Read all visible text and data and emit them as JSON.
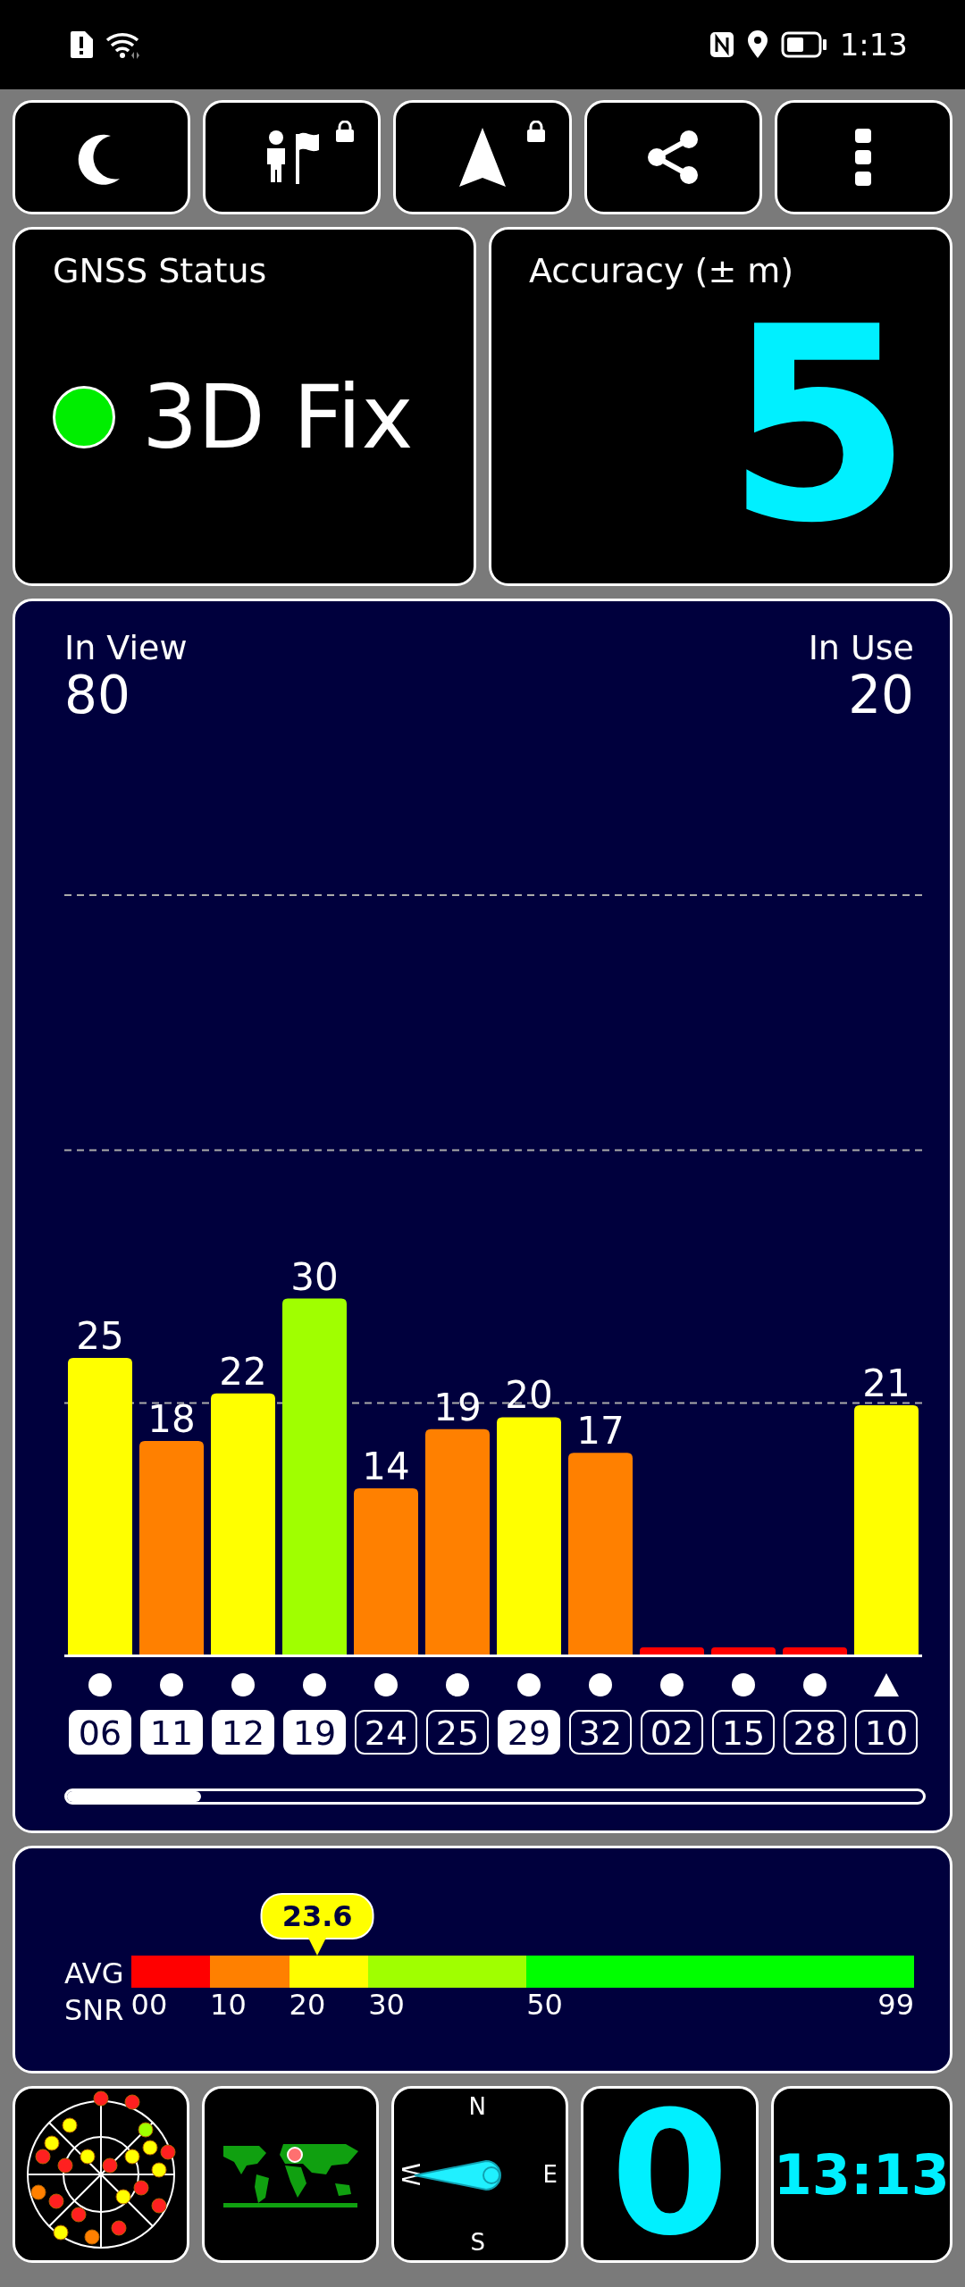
{
  "status_bar": {
    "time": "1:13"
  },
  "toolbar": [
    {
      "locked": false
    },
    {
      "locked": true
    },
    {
      "locked": true
    },
    {
      "locked": false
    },
    {
      "locked": false
    }
  ],
  "gnss_status": {
    "title": "GNSS Status",
    "fix": "3D Fix",
    "color": "#00ee00"
  },
  "accuracy": {
    "title": "Accuracy (± m)",
    "value": "5"
  },
  "satellites_panel": {
    "in_view_label": "In View",
    "in_view": "80",
    "in_use_label": "In Use",
    "in_use": "20",
    "chart_data": {
      "type": "bar",
      "categories": [
        "06",
        "11",
        "12",
        "19",
        "24",
        "25",
        "29",
        "32",
        "02",
        "15",
        "28",
        "10"
      ],
      "values": [
        25,
        18,
        22,
        30,
        14,
        19,
        20,
        17,
        0.6,
        0.6,
        0.6,
        21
      ],
      "ylim": [
        0,
        64
      ],
      "ref_lines": [
        {
          "axis": "y",
          "value": 64
        },
        {
          "axis": "y",
          "value": 42.5
        },
        {
          "axis": "y",
          "value": 21.2
        }
      ],
      "value_labels": [
        "25",
        "18",
        "22",
        "30",
        "14",
        "19",
        "20",
        "17",
        null,
        null,
        null,
        "21"
      ]
    },
    "satellites": [
      {
        "used": true,
        "kind": "circle"
      },
      {
        "used": true,
        "kind": "circle"
      },
      {
        "used": true,
        "kind": "circle"
      },
      {
        "used": true,
        "kind": "circle"
      },
      {
        "used": false,
        "kind": "circle"
      },
      {
        "used": false,
        "kind": "circle"
      },
      {
        "used": true,
        "kind": "circle"
      },
      {
        "used": false,
        "kind": "circle"
      },
      {
        "used": false,
        "kind": "circle"
      },
      {
        "used": false,
        "kind": "circle"
      },
      {
        "used": false,
        "kind": "circle"
      },
      {
        "used": false,
        "kind": "triangle"
      }
    ]
  },
  "snr_panel": {
    "label_top": "AVG",
    "label_bottom": "SNR",
    "average": "23.6",
    "segments": [
      {
        "tick": "00",
        "color": "#ff0000"
      },
      {
        "tick": "10",
        "color": "#ff8000"
      },
      {
        "tick": "20",
        "color": "#ffff00"
      },
      {
        "tick": "30",
        "color": "#a0ff00"
      },
      {
        "tick": "50",
        "color": "#00ff00"
      }
    ],
    "end_tick": "99"
  },
  "tiles": {
    "compass": [
      "N",
      "E",
      "S",
      "W"
    ],
    "speed": "0",
    "clock": "13:13"
  }
}
